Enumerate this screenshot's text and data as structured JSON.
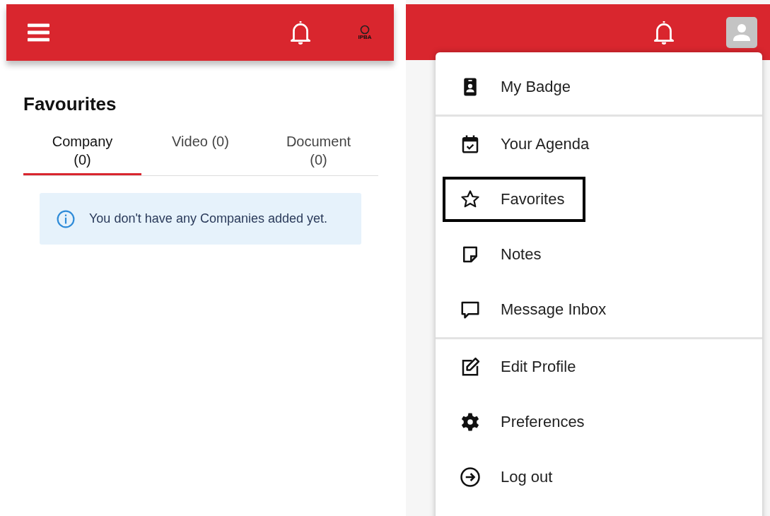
{
  "left_panel": {
    "header": {
      "logo_text": "IPBA"
    },
    "title": "Favourites",
    "tabs": [
      {
        "label": "Company (0)",
        "selected": true
      },
      {
        "label": "Video (0)",
        "selected": false
      },
      {
        "label": "Document (0)",
        "selected": false
      }
    ],
    "notice": "You don't have any Companies added yet."
  },
  "right_panel": {
    "menu": [
      {
        "label": "My Badge",
        "divider_after": true,
        "highlighted": false
      },
      {
        "label": "Your Agenda",
        "divider_after": false,
        "highlighted": false
      },
      {
        "label": "Favorites",
        "divider_after": false,
        "highlighted": true
      },
      {
        "label": "Notes",
        "divider_after": false,
        "highlighted": false
      },
      {
        "label": "Message Inbox",
        "divider_after": true,
        "highlighted": false
      },
      {
        "label": "Edit Profile",
        "divider_after": false,
        "highlighted": false
      },
      {
        "label": "Preferences",
        "divider_after": false,
        "highlighted": false
      },
      {
        "label": "Log out",
        "divider_after": false,
        "highlighted": false
      }
    ]
  }
}
